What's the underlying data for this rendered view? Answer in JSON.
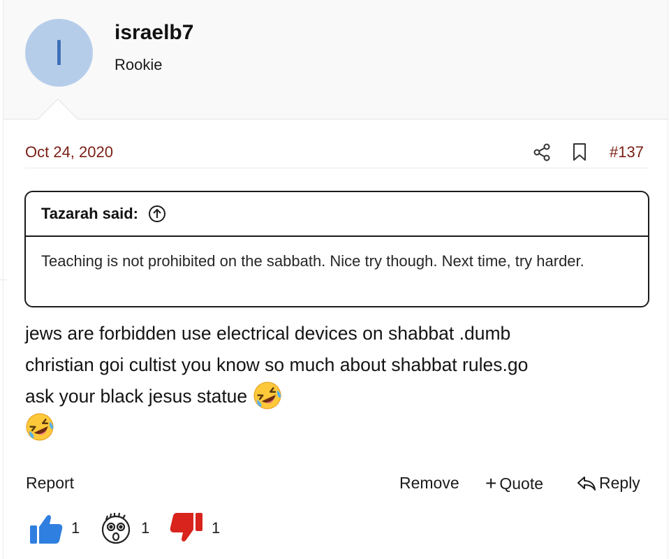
{
  "user": {
    "avatar_letter": "I",
    "avatar_color": "#b6cdea",
    "username": "israelb7",
    "title": "Rookie"
  },
  "post": {
    "date": "Oct 24, 2020",
    "number": "#137",
    "share_icon": "share-icon",
    "bookmark_icon": "bookmark-icon",
    "accent_color": "#7a1e14",
    "line1": "jews are forbidden use electrical devices on shabbat .dumb",
    "line2": "christian goi cultist you know so much about shabbat rules.go",
    "line3": "ask your black jesus statue",
    "emoji": "rolling-on-floor-laughing"
  },
  "quote": {
    "author": "Tazarah said:",
    "text": "Teaching is not prohibited on the sabbath. Nice try though. Next time, try harder."
  },
  "actions": {
    "report": "Report",
    "remove": "Remove",
    "quote": "Quote",
    "reply": "Reply"
  },
  "reactions": [
    {
      "icon": "thumbs-up-icon",
      "count": "1"
    },
    {
      "icon": "shocked-face-icon",
      "count": "1"
    },
    {
      "icon": "thumbs-down-icon",
      "count": "1"
    }
  ]
}
